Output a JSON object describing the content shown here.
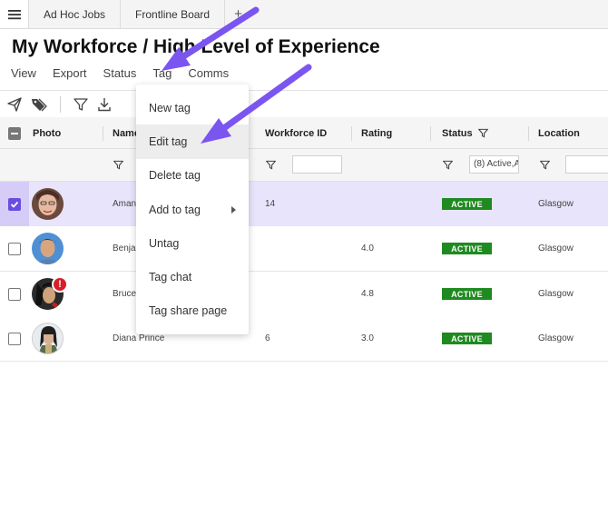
{
  "tabs": [
    "Ad Hoc Jobs",
    "Frontline Board"
  ],
  "tab_add": "+",
  "page_title": "My Workforce / High Level of Experience",
  "menu": [
    "View",
    "Export",
    "Status",
    "Tag",
    "Comms"
  ],
  "columns": {
    "photo": "Photo",
    "name": "Name",
    "workforce_id": "Workforce ID",
    "rating": "Rating",
    "status": "Status",
    "location": "Location"
  },
  "filters": {
    "status_value": "(8) Active,A",
    "workforce_id_value": "",
    "location_value": ""
  },
  "rows": [
    {
      "name": "Aman",
      "workforce_id": "14",
      "rating": "",
      "status": "ACTIVE",
      "location": "Glasgow",
      "selected": true,
      "alert": ""
    },
    {
      "name": "Benja",
      "workforce_id": "",
      "rating": "4.0",
      "status": "ACTIVE",
      "location": "Glasgow",
      "selected": false,
      "alert": ""
    },
    {
      "name": "Bruce",
      "workforce_id": "",
      "rating": "4.8",
      "status": "ACTIVE",
      "location": "Glasgow",
      "selected": false,
      "alert": "!"
    },
    {
      "name": "Diana Prince",
      "workforce_id": "6",
      "rating": "3.0",
      "status": "ACTIVE",
      "location": "Glasgow",
      "selected": false,
      "alert": ""
    }
  ],
  "tag_menu": [
    "New tag",
    "Edit tag",
    "Delete tag",
    "Add to tag",
    "Untag",
    "Tag chat",
    "Tag share page"
  ],
  "icons": {
    "hamburger": "hamburger-icon",
    "send": "send-icon",
    "tag": "tag-icon",
    "filter": "filter-icon",
    "download": "download-icon"
  },
  "colors": {
    "accent": "#6a4ce0",
    "selected_row": "#e8e4fb",
    "status_active": "#1f8a20",
    "alert": "#d81e2a",
    "annotation_arrow": "#7b55f0"
  }
}
